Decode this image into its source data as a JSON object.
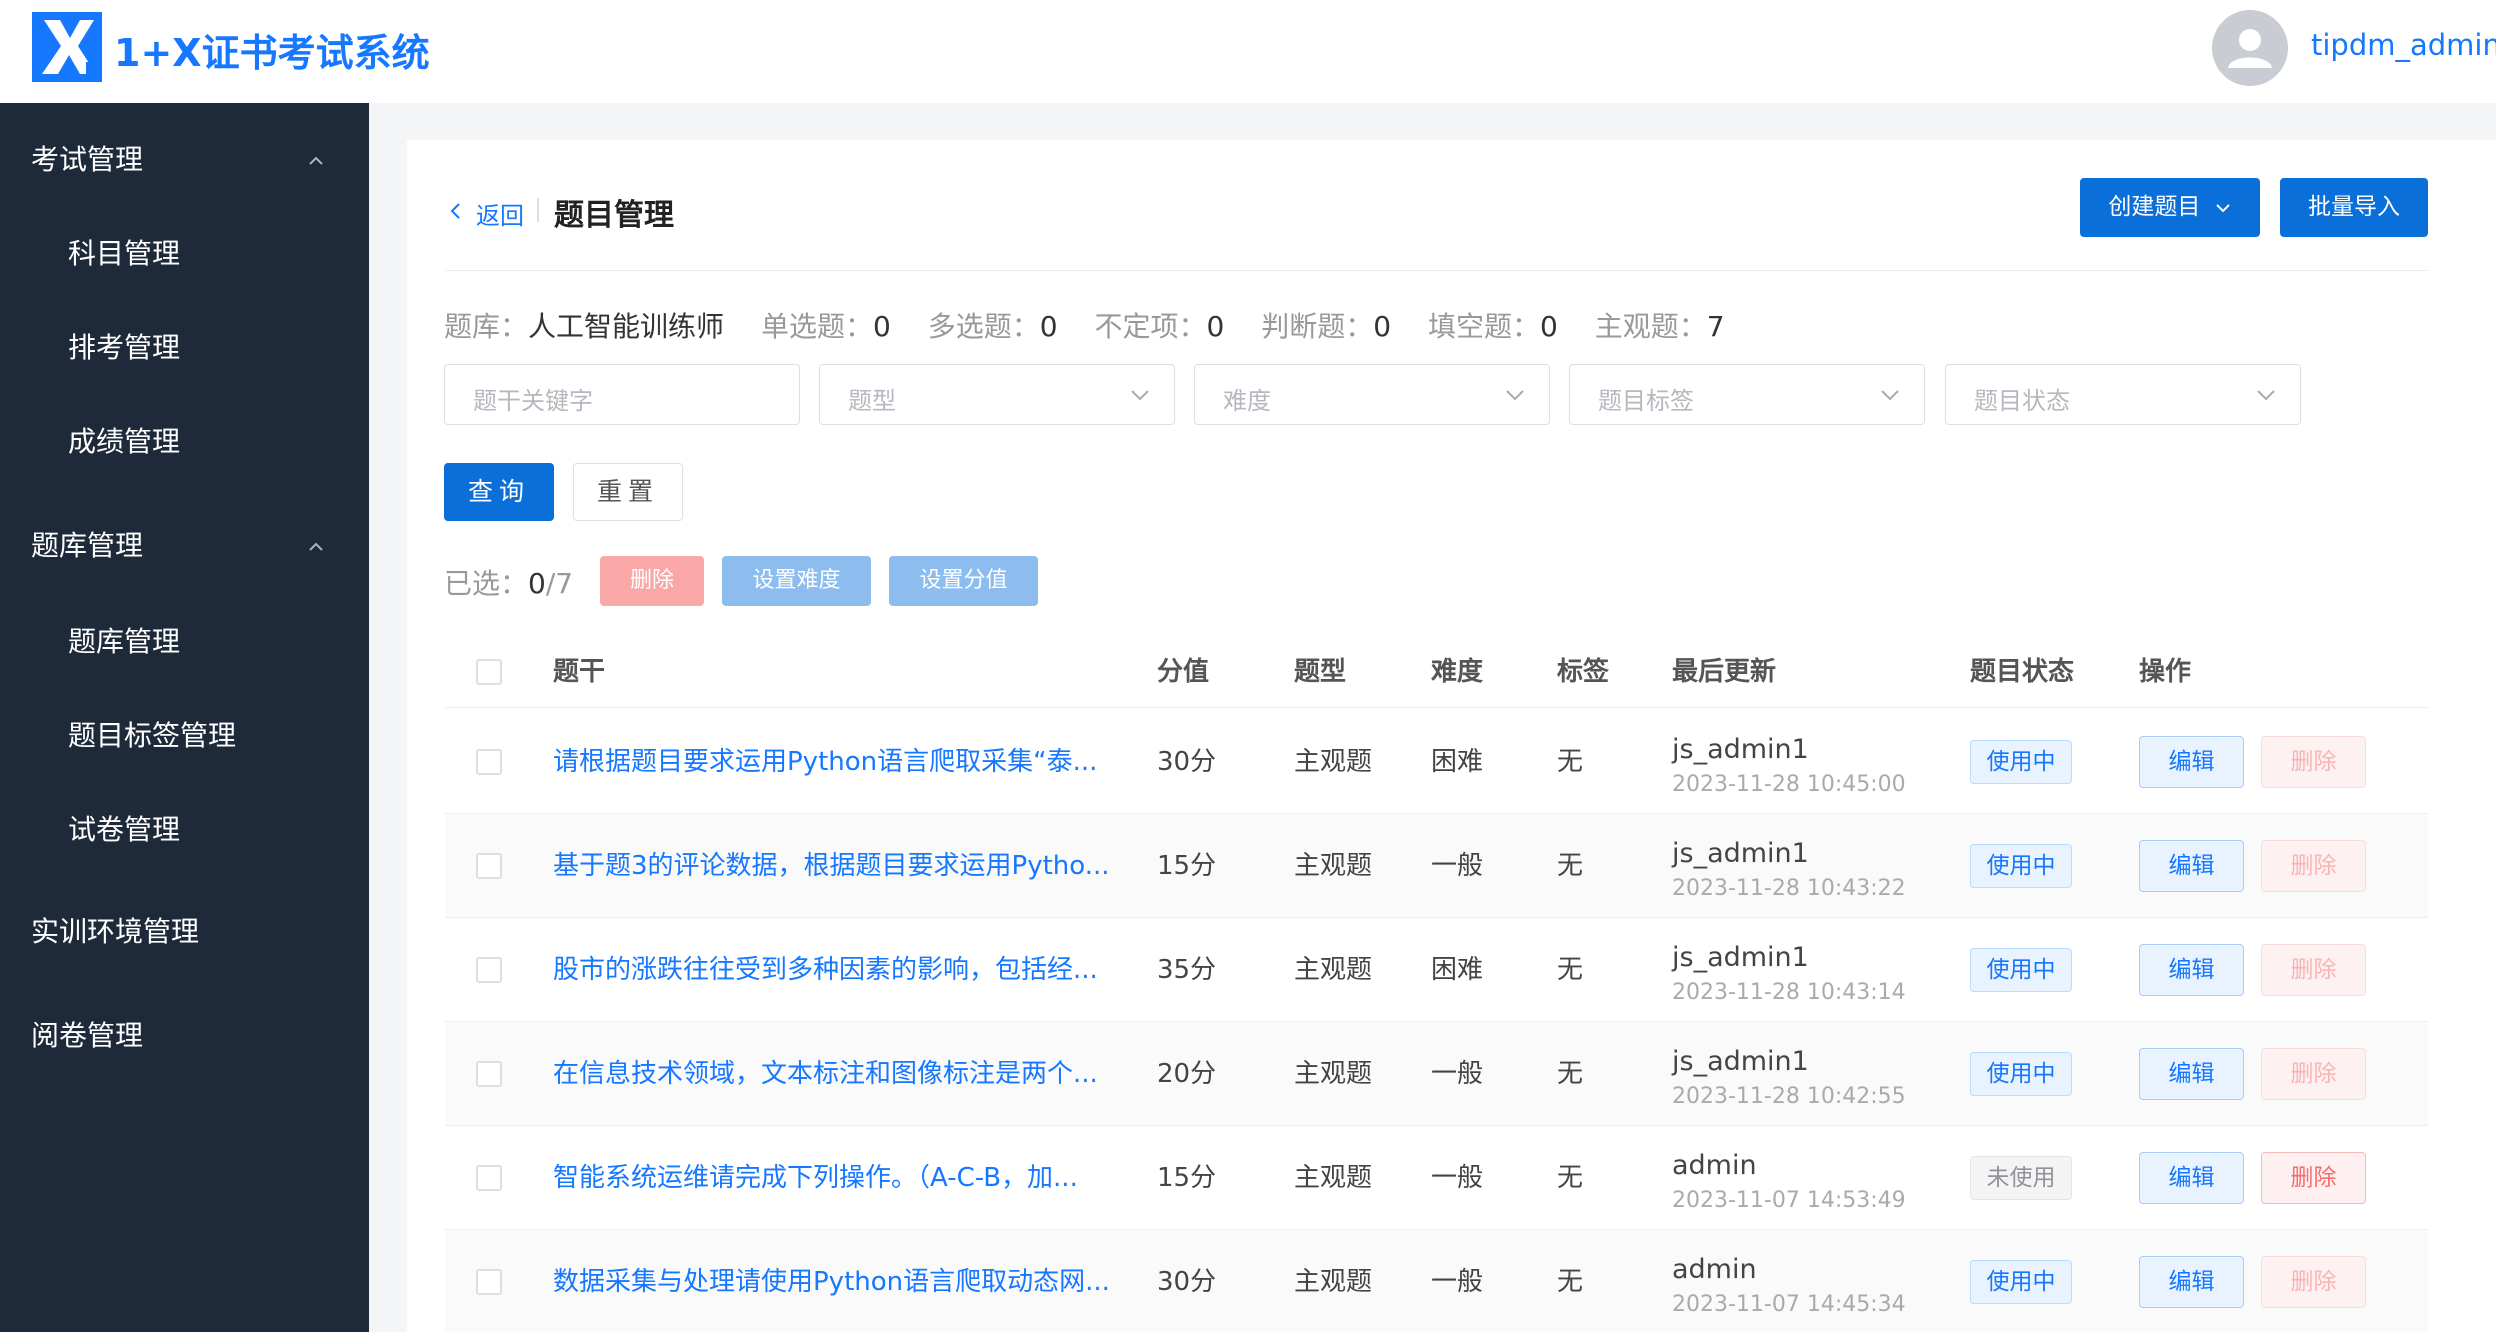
{
  "header": {
    "app_title": "1+X证书考试系统",
    "username": "tipdm_admin"
  },
  "sidebar": {
    "groups": [
      {
        "label": "考试管理",
        "expanded": true,
        "items": [
          "科目管理",
          "排考管理",
          "成绩管理"
        ]
      },
      {
        "label": "题库管理",
        "expanded": true,
        "items": [
          "题库管理",
          "题目标签管理",
          "试卷管理"
        ]
      },
      {
        "label": "实训环境管理"
      },
      {
        "label": "阅卷管理"
      }
    ]
  },
  "page": {
    "back_label": "返回",
    "title": "题目管理",
    "create_button": "创建题目",
    "import_button": "批量导入"
  },
  "stats": {
    "bank_label": "题库：",
    "bank_value": "人工智能训练师",
    "single_label": "单选题：",
    "single_value": "0",
    "multi_label": "多选题：",
    "multi_value": "0",
    "indef_label": "不定项：",
    "indef_value": "0",
    "judge_label": "判断题：",
    "judge_value": "0",
    "fill_label": "填空题：",
    "fill_value": "0",
    "subjective_label": "主观题：",
    "subjective_value": "7"
  },
  "filters": {
    "keyword_placeholder": "题干关键字",
    "type_placeholder": "题型",
    "difficulty_placeholder": "难度",
    "tag_placeholder": "题目标签",
    "status_placeholder": "题目状态",
    "query_button": "查询",
    "reset_button": "重置"
  },
  "bulk": {
    "selected_label": "已选：",
    "selected_count": "0",
    "selected_total": "/7",
    "delete_button": "删除",
    "set_difficulty_button": "设置难度",
    "set_score_button": "设置分值"
  },
  "table": {
    "headers": {
      "stem": "题干",
      "score": "分值",
      "type": "题型",
      "difficulty": "难度",
      "tag": "标签",
      "updated": "最后更新",
      "status": "题目状态",
      "actions": "操作"
    },
    "edit_label": "编辑",
    "delete_label": "删除",
    "rows": [
      {
        "stem": "请根据题目要求运用Python语言爬取采集“泰...",
        "score": "30分",
        "type": "主观题",
        "difficulty": "困难",
        "tag": "无",
        "user": "js_admin1",
        "time": "2023-11-28 10:45:00",
        "status": "使用中",
        "status_active": true
      },
      {
        "stem": "基于题3的评论数据，根据题目要求运用Pytho...",
        "score": "15分",
        "type": "主观题",
        "difficulty": "一般",
        "tag": "无",
        "user": "js_admin1",
        "time": "2023-11-28 10:43:22",
        "status": "使用中",
        "status_active": true
      },
      {
        "stem": "股市的涨跌往往受到多种因素的影响，包括经...",
        "score": "35分",
        "type": "主观题",
        "difficulty": "困难",
        "tag": "无",
        "user": "js_admin1",
        "time": "2023-11-28 10:43:14",
        "status": "使用中",
        "status_active": true
      },
      {
        "stem": "在信息技术领域，文本标注和图像标注是两个...",
        "score": "20分",
        "type": "主观题",
        "difficulty": "一般",
        "tag": "无",
        "user": "js_admin1",
        "time": "2023-11-28 10:42:55",
        "status": "使用中",
        "status_active": true
      },
      {
        "stem": "智能系统运维请完成下列操作。（A-C-B，加...",
        "score": "15分",
        "type": "主观题",
        "difficulty": "一般",
        "tag": "无",
        "user": "admin",
        "time": "2023-11-07 14:53:49",
        "status": "未使用",
        "status_active": false
      },
      {
        "stem": "数据采集与处理请使用Python语言爬取动态网...",
        "score": "30分",
        "type": "主观题",
        "difficulty": "一般",
        "tag": "无",
        "user": "admin",
        "time": "2023-11-07 14:45:34",
        "status": "使用中",
        "status_active": true
      }
    ]
  },
  "colors": {
    "primary": "#0a6fd8",
    "link": "#1677ff",
    "sidebar_bg": "#1e2a3a",
    "danger": "#f56c6c"
  }
}
